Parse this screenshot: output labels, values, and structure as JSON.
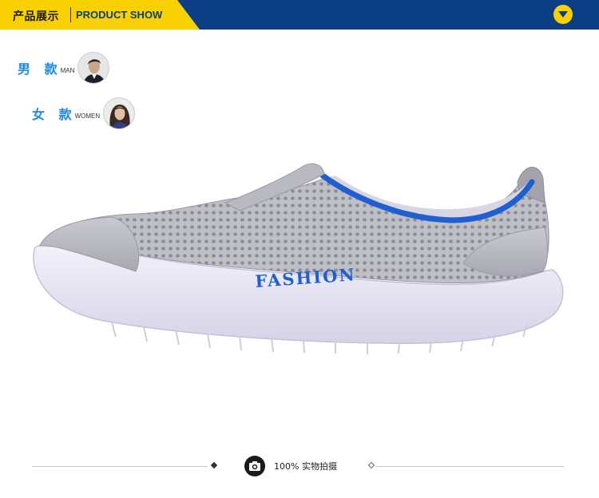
{
  "header": {
    "title_cn": "产品展示",
    "title_en": "PRODUCT SHOW",
    "dropdown_icon": "chevron-down-icon",
    "colors": {
      "banner": "#0b3e84",
      "accent": "#f9d100"
    }
  },
  "genders": [
    {
      "label_cn": "男 款",
      "label_en": "MAN"
    },
    {
      "label_cn": "女 款",
      "label_en": "WOMEN"
    }
  ],
  "product": {
    "brand_text": "FASHION",
    "colors": {
      "upper": "#b4b4bb",
      "trim": "#1f5fd1",
      "sole": "#eceaf6"
    }
  },
  "footer": {
    "text": "100% 实物拍摄",
    "icon": "camera-icon"
  }
}
